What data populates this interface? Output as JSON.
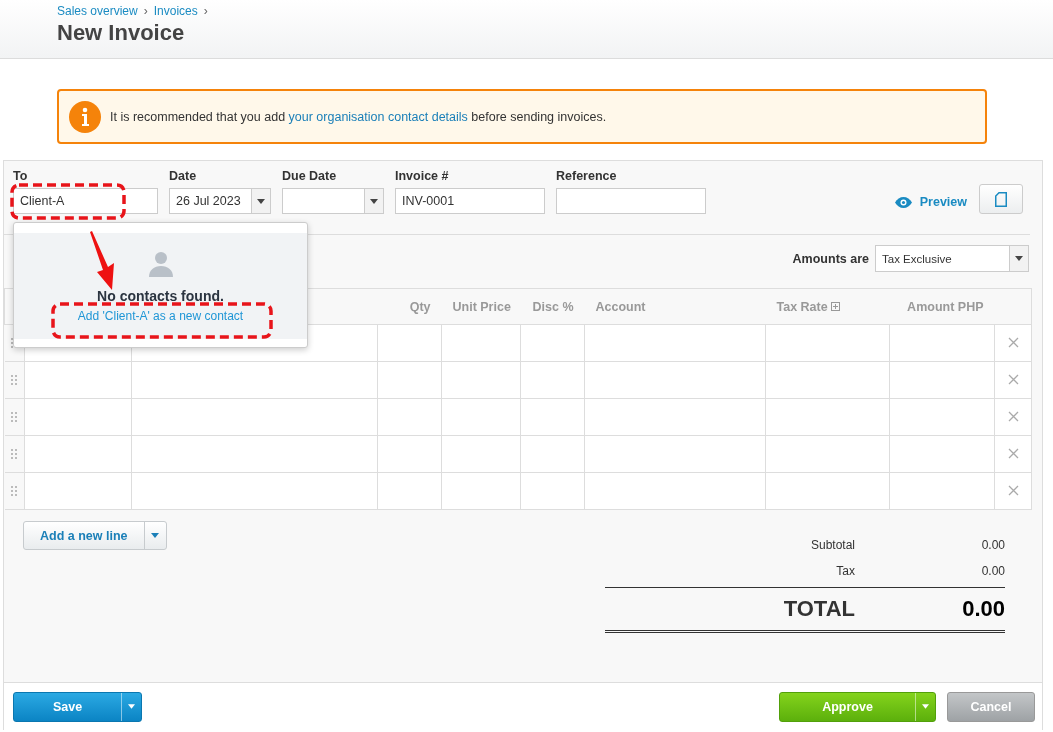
{
  "breadcrumbs": [
    {
      "label": "Sales overview",
      "sep": "›"
    },
    {
      "label": "Invoices",
      "sep": "›"
    }
  ],
  "title": "New Invoice",
  "alert": {
    "text_before": "It is recommended that you add ",
    "link": "your organisation contact details",
    "text_after": " before sending invoices."
  },
  "fields": [
    {
      "label": "To",
      "value": "Client-A",
      "kind": "text"
    },
    {
      "label": "Date",
      "value": "26 Jul 2023",
      "kind": "date"
    },
    {
      "label": "Due Date",
      "kind": "date"
    },
    {
      "label": "Invoice #",
      "value": "INV-0001",
      "kind": "text"
    },
    {
      "label": "Reference",
      "kind": "text"
    }
  ],
  "preview": {
    "label": "Preview"
  },
  "amounts": {
    "label": "Amounts are",
    "value": "Tax Exclusive"
  },
  "contact_dropdown": {
    "message": "No contacts found.",
    "add_link": "Add 'Client-A' as a new contact"
  },
  "table": {
    "columns": [
      {
        "label": "Qty",
        "expandable": false
      },
      {
        "label": "Unit Price",
        "expandable": false
      },
      {
        "label": "Disc %",
        "expandable": false
      },
      {
        "label": "Account",
        "expandable": false
      },
      {
        "label": "Tax Rate",
        "expandable": true
      },
      {
        "label": "Amount PHP",
        "expandable": false
      }
    ],
    "rows": [
      {
        "removable": true
      },
      {
        "removable": true
      },
      {
        "removable": true
      },
      {
        "removable": true
      },
      {
        "removable": true
      }
    ]
  },
  "add_line": "Add a new line",
  "totals": [
    {
      "label": "Subtotal",
      "value": "0.00",
      "kind": "line"
    },
    {
      "label": "Tax",
      "value": "0.00",
      "kind": "line"
    },
    {
      "label": "TOTAL",
      "value": "0.00",
      "kind": "grand"
    }
  ],
  "footer": {
    "save": "Save",
    "approve": "Approve",
    "cancel": "Cancel"
  }
}
